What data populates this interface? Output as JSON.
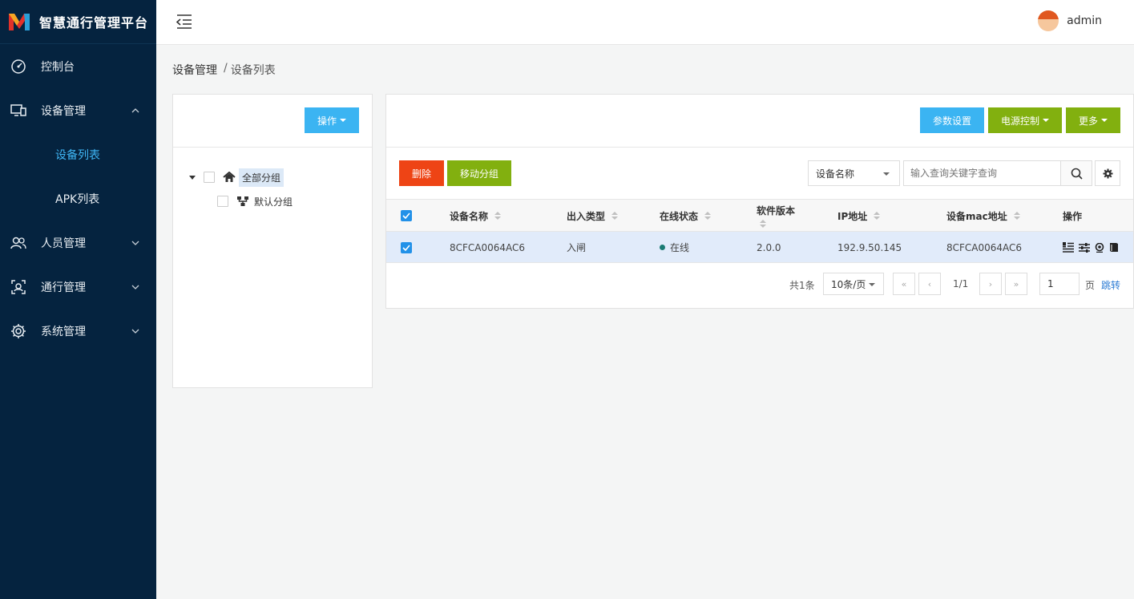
{
  "app": {
    "title": "智慧通行管理平台"
  },
  "sidebar": {
    "items": [
      {
        "label": "控制台"
      },
      {
        "label": "设备管理"
      },
      {
        "label": "设备列表"
      },
      {
        "label": "APK列表"
      },
      {
        "label": "人员管理"
      },
      {
        "label": "通行管理"
      },
      {
        "label": "系统管理"
      }
    ]
  },
  "header": {
    "username": "admin"
  },
  "breadcrumb": {
    "level1": "设备管理",
    "separator": "/",
    "level2": "设备列表"
  },
  "left_panel": {
    "action_label": "操作",
    "tree": [
      {
        "label": "全部分组"
      },
      {
        "label": "默认分组"
      }
    ]
  },
  "right_panel": {
    "params_label": "参数设置",
    "power_label": "电源控制",
    "more_label": "更多",
    "delete_label": "删除",
    "move_label": "移动分组",
    "search_field": "设备名称",
    "search_placeholder": "输入查询关键字查询"
  },
  "table": {
    "headers": [
      "设备名称",
      "出入类型",
      "在线状态",
      "软件版本",
      "IP地址",
      "设备mac地址",
      "操作"
    ],
    "rows": [
      {
        "name": "8CFCA0064AC6",
        "type": "入闸",
        "status": "在线",
        "version": "2.0.0",
        "ip": "192.9.50.145",
        "mac": "8CFCA0064AC6"
      }
    ]
  },
  "pagination": {
    "total": "共1条",
    "page_size": "10条/页",
    "first": "«",
    "prev": "‹",
    "info": "1/1",
    "next": "›",
    "last": "»",
    "page_value": "1",
    "unit": "页",
    "jump": "跳转"
  },
  "colors": {
    "sidebar": "#05233f",
    "accent_blue": "#3bb4f2",
    "green": "#82b00f",
    "red": "#ee4415",
    "active": "#3fb6f5"
  }
}
